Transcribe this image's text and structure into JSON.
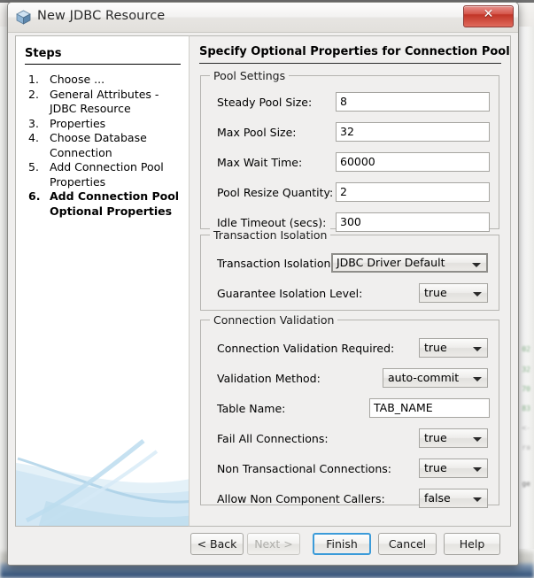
{
  "window": {
    "title": "New JDBC Resource",
    "icon": "cube-icon",
    "close_label": "✕"
  },
  "sidebar": {
    "heading": "Steps",
    "steps": [
      {
        "num": "1.",
        "label": "Choose ...",
        "current": false
      },
      {
        "num": "2.",
        "label": "General Attributes - JDBC Resource",
        "current": false
      },
      {
        "num": "3.",
        "label": "Properties",
        "current": false
      },
      {
        "num": "4.",
        "label": "Choose Database Connection",
        "current": false
      },
      {
        "num": "5.",
        "label": "Add Connection Pool Properties",
        "current": false
      },
      {
        "num": "6.",
        "label": "Add Connection Pool Optional Properties",
        "current": true
      }
    ]
  },
  "content": {
    "title": "Specify Optional Properties for Connection Pool",
    "groups": [
      {
        "title": "Pool Settings",
        "fields": [
          {
            "label": "Steady Pool Size:",
            "type": "text",
            "value": "8"
          },
          {
            "label": "Max Pool Size:",
            "type": "text",
            "value": "32"
          },
          {
            "label": "Max Wait Time:",
            "type": "text",
            "value": "60000"
          },
          {
            "label": "Pool Resize Quantity:",
            "type": "text",
            "value": "2"
          },
          {
            "label": "Idle Timeout (secs):",
            "type": "text",
            "value": "300"
          }
        ]
      },
      {
        "title": "Transaction Isolation",
        "fields": [
          {
            "label": "Transaction Isolation:",
            "type": "combo",
            "value": "JDBC Driver Default",
            "focused": true
          },
          {
            "label": "Guarantee Isolation Level:",
            "type": "combo",
            "value": "true",
            "focused": false
          }
        ]
      },
      {
        "title": "Connection Validation",
        "fields": [
          {
            "label": "Connection Validation Required:",
            "type": "combo",
            "value": "true",
            "focused": false
          },
          {
            "label": "Validation Method:",
            "type": "combo",
            "value": "auto-commit",
            "focused": false
          },
          {
            "label": "Table Name:",
            "type": "text",
            "value": "TAB_NAME"
          },
          {
            "label": "Fail All Connections:",
            "type": "combo",
            "value": "true",
            "focused": false
          },
          {
            "label": "Non Transactional Connections:",
            "type": "combo",
            "value": "true",
            "focused": false
          },
          {
            "label": "Allow Non Component Callers:",
            "type": "combo",
            "value": "false",
            "focused": false
          }
        ]
      }
    ]
  },
  "buttons": [
    {
      "label": "< Back",
      "state": "normal"
    },
    {
      "label": "Next >",
      "state": "disabled"
    },
    {
      "label": "Finish",
      "state": "default"
    },
    {
      "label": "Cancel",
      "state": "normal"
    },
    {
      "label": "Help",
      "state": "normal"
    }
  ],
  "colors": {
    "dialog_bg": "#f0efee",
    "close_red": "#c13527",
    "focus_blue": "#3b9bd9",
    "swoosh_blue": "#c8e0ef"
  }
}
